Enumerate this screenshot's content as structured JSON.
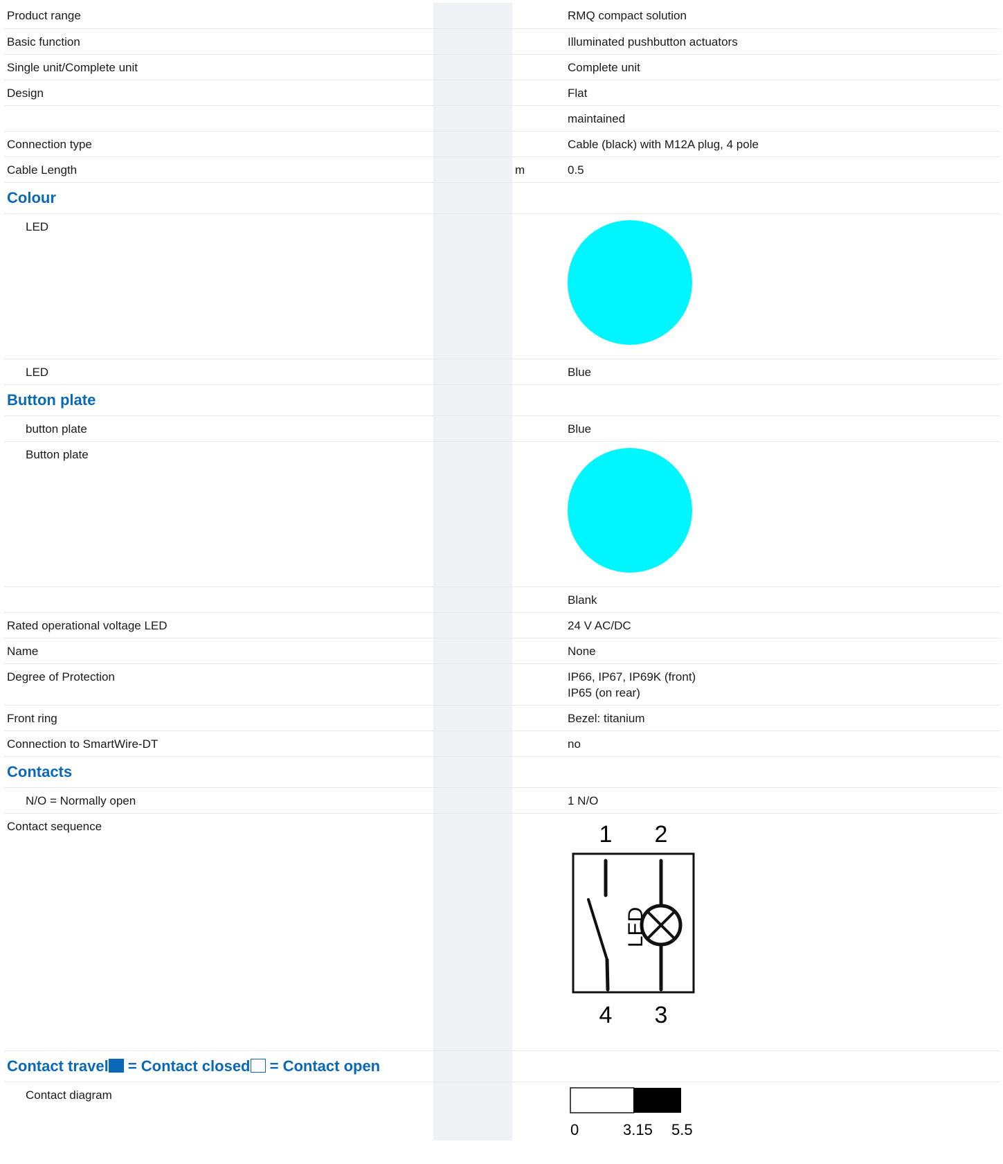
{
  "rows": {
    "product_range": {
      "label": "Product range",
      "value": "RMQ compact solution"
    },
    "basic_function": {
      "label": "Basic function",
      "value": "Illuminated pushbutton actuators"
    },
    "single_complete": {
      "label": "Single unit/Complete unit",
      "value": "Complete unit"
    },
    "design": {
      "label": "Design",
      "value": "Flat"
    },
    "design2": {
      "label": "",
      "value": "maintained"
    },
    "connection_type": {
      "label": "Connection type",
      "value": "Cable (black) with M12A plug, 4 pole"
    },
    "cable_length": {
      "label": "Cable Length",
      "unit": "m",
      "value": "0.5"
    }
  },
  "colour": {
    "title": "Colour",
    "led_swatch_label": "LED",
    "led_swatch_color": "#00f6ff",
    "led_label": "LED",
    "led_value": "Blue"
  },
  "button_plate": {
    "title": "Button plate",
    "plate_label": "button plate",
    "plate_value": "Blue",
    "plate_swatch_label": "Button plate",
    "plate_swatch_color": "#00f6ff",
    "blank_value": "Blank"
  },
  "rows2": {
    "voltage": {
      "label": "Rated operational voltage LED",
      "value": "24 V AC/DC"
    },
    "name": {
      "label": "Name",
      "value": "None"
    },
    "protection": {
      "label": "Degree of Protection",
      "value_line1": "IP66, IP67, IP69K (front)",
      "value_line2": "IP65 (on rear)"
    },
    "front_ring": {
      "label": "Front ring",
      "value": "Bezel: titanium"
    },
    "smartwire": {
      "label": "Connection to SmartWire-DT",
      "value": "no"
    }
  },
  "contacts": {
    "title": "Contacts",
    "no_label": "N/O = Normally open",
    "no_value": "1 N/O",
    "sequence_label": "Contact sequence",
    "diagram": {
      "top_left": "1",
      "top_right": "2",
      "bottom_left": "4",
      "bottom_right": "3",
      "lamp_label": "LED"
    }
  },
  "travel": {
    "title_part1": "Contact travel",
    "title_part2": " = Contact closed",
    "title_part3": " = Contact open",
    "diagram_label": "Contact diagram",
    "ticks": [
      "0",
      "3.15",
      "5.5"
    ],
    "closed_from": 3.15,
    "closed_to": 5.5
  }
}
